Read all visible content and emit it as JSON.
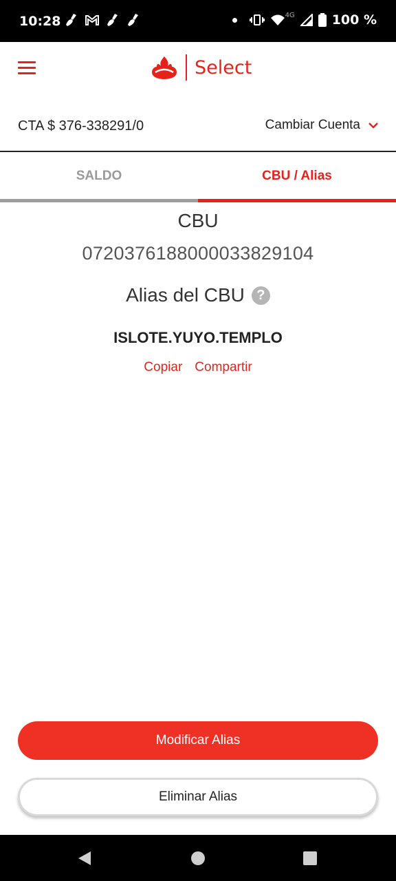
{
  "status_bar": {
    "time": "10:28",
    "network": "4G",
    "battery": "100 %"
  },
  "header": {
    "logo_text": "Select"
  },
  "account": {
    "number": "CTA $ 376-338291/0",
    "change_label": "Cambiar Cuenta"
  },
  "tabs": [
    {
      "label": "SALDO",
      "active": false
    },
    {
      "label": "CBU / Alias",
      "active": true
    }
  ],
  "cbu": {
    "label": "CBU",
    "number": "0720376188000033829104"
  },
  "alias": {
    "title": "Alias del CBU",
    "help": "?",
    "value": "ISLOTE.YUYO.TEMPLO",
    "copy_label": "Copiar",
    "share_label": "Compartir"
  },
  "buttons": {
    "modify": "Modificar Alias",
    "delete": "Eliminar Alias"
  },
  "colors": {
    "brand_red": "#e5231b",
    "button_red": "#ee3124"
  }
}
